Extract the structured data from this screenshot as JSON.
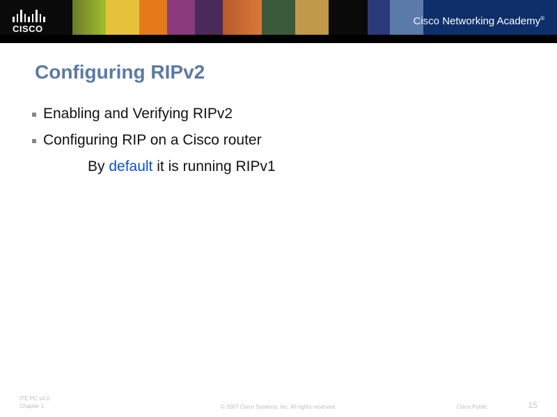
{
  "header": {
    "brand": "CISCO",
    "academy_light": "Cisco ",
    "academy_bold": "Networking Academy",
    "reg": "®"
  },
  "slide": {
    "title": "Configuring RIPv2",
    "bullets": [
      "Enabling and Verifying RIPv2",
      "Configuring RIP on a Cisco router"
    ],
    "subline_prefix": "By ",
    "subline_highlight": "default",
    "subline_suffix": " it is running RIPv1"
  },
  "footer": {
    "left_line1": "ITE PC v4.0",
    "left_line2": "Chapter 1",
    "center": "© 2007 Cisco Systems, Inc. All rights reserved.",
    "right": "Cisco Public",
    "page": "15"
  }
}
